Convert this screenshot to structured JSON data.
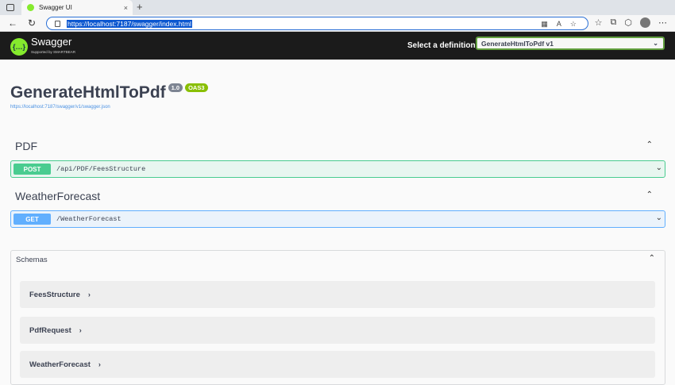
{
  "browser": {
    "tab_title": "Swagger UI",
    "tab_close": "×",
    "new_tab": "+",
    "url": "https://localhost:7187/swagger/index.html"
  },
  "topbar": {
    "logo_text": "Swagger",
    "logo_sub": "Supported by SMARTBEAR",
    "definition_label": "Select a definition",
    "definition_selected": "GenerateHtmlToPdf v1"
  },
  "info": {
    "title": "GenerateHtmlToPdf",
    "version_badge": "1.0",
    "oas_badge": "OAS3",
    "spec_link": "https://localhost:7187/swagger/v1/swagger.json"
  },
  "sections": [
    {
      "title": "PDF",
      "operations": [
        {
          "method": "POST",
          "path": "/api/PDF/FeesStructure"
        }
      ]
    },
    {
      "title": "WeatherForecast",
      "operations": [
        {
          "method": "GET",
          "path": "/WeatherForecast"
        }
      ]
    }
  ],
  "schemas": {
    "title": "Schemas",
    "models": [
      "FeesStructure",
      "PdfRequest",
      "WeatherForecast"
    ]
  },
  "colors": {
    "post": "#49cc90",
    "get": "#61affe",
    "topbar": "#1b1b1b",
    "accent": "#85ea2d"
  }
}
